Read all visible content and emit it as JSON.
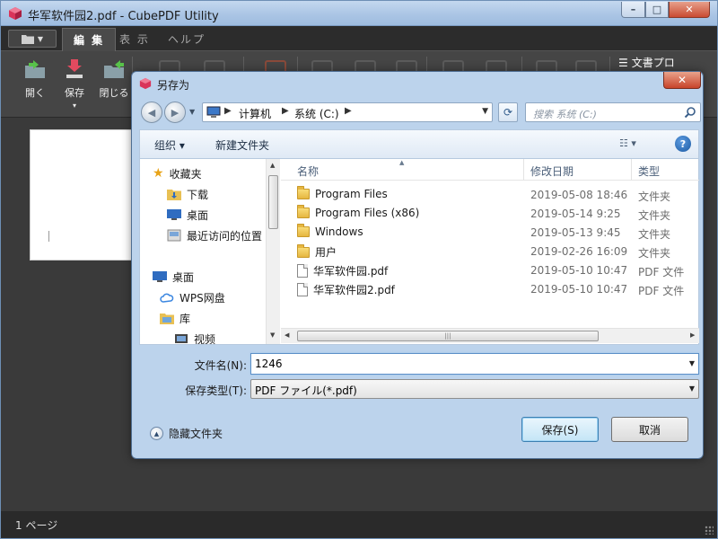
{
  "app": {
    "title": "华军软件园2.pdf - CubePDF Utility",
    "window_controls": {
      "minimize": "–",
      "maximize": "□",
      "close": "✕"
    },
    "menu": {
      "file_icon": "folder-icon",
      "tabs": [
        {
          "label": "編 集",
          "active": true
        },
        {
          "label": "表 示",
          "active": false
        },
        {
          "label": "ヘルプ",
          "active": false
        }
      ]
    },
    "ribbon": {
      "buttons": [
        {
          "label": "開く",
          "icon": "open-icon"
        },
        {
          "label": "保存",
          "icon": "save-icon",
          "dropdown": "▾"
        },
        {
          "label": "閉じる",
          "icon": "close-doc-icon"
        }
      ],
      "text_button": "文書プロ"
    },
    "status": {
      "pages": "1 ページ"
    },
    "colors": {
      "accent": "#4a4a4a",
      "titlebar": "#a9c4e4"
    }
  },
  "dialog": {
    "title": "另存为",
    "close": "✕",
    "address": {
      "crumbs": [
        "计算机",
        "系统 (C:)"
      ],
      "search_placeholder": "搜索 系统 (C:)"
    },
    "toolbar": {
      "organize": "组织 ▾",
      "new_folder": "新建文件夹",
      "view": "☷ ▾",
      "help": "?"
    },
    "nav": {
      "favorites": "收藏夹",
      "downloads": "下载",
      "desktop_fav": "桌面",
      "recent": "最近访问的位置",
      "desktop": "桌面",
      "wps": "WPS网盘",
      "library": "库",
      "videos": "视频"
    },
    "columns": {
      "name": "名称",
      "date": "修改日期",
      "type": "类型"
    },
    "files": [
      {
        "name": "Program Files",
        "date": "2019-05-08 18:46",
        "type": "文件夹",
        "kind": "folder"
      },
      {
        "name": "Program Files (x86)",
        "date": "2019-05-14 9:25",
        "type": "文件夹",
        "kind": "folder"
      },
      {
        "name": "Windows",
        "date": "2019-05-13 9:45",
        "type": "文件夹",
        "kind": "folder"
      },
      {
        "name": "用户",
        "date": "2019-02-26 16:09",
        "type": "文件夹",
        "kind": "folder"
      },
      {
        "name": "华军软件园.pdf",
        "date": "2019-05-10 10:47",
        "type": "PDF 文件",
        "kind": "pdf"
      },
      {
        "name": "华军软件园2.pdf",
        "date": "2019-05-10 10:47",
        "type": "PDF 文件",
        "kind": "pdf"
      }
    ],
    "filename_label": "文件名(N):",
    "filename_value": "1246",
    "filetype_label": "保存类型(T):",
    "filetype_value": "PDF ファイル(*.pdf)",
    "hide_folders": "隐藏文件夹",
    "save_button": "保存(S)",
    "cancel_button": "取消"
  }
}
